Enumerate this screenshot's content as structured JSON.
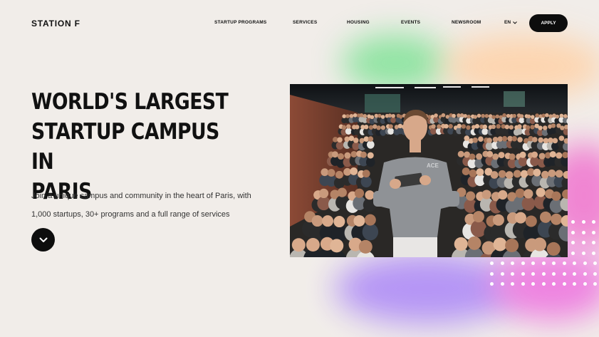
{
  "brand": {
    "name": "STATION F"
  },
  "nav": {
    "items": [
      "STARTUP PROGRAMS",
      "SERVICES",
      "HOUSING",
      "EVENTS",
      "NEWSROOM"
    ],
    "language": "EN",
    "cta_label": "APPLY"
  },
  "hero": {
    "title": "WORLD'S LARGEST\nSTARTUP CAMPUS IN\nPARIS",
    "subtitle": "Join a unique campus and community in the heart of Paris, with 1,000 startups, 30+ programs and a full range of services"
  },
  "icons": {
    "scroll": "chevron-down-icon",
    "language_caret": "chevron-down-icon"
  },
  "colors": {
    "background": "#f1ede9",
    "button": "#0d0d0d",
    "glow_green": "#86e39b",
    "glow_orange": "#ffd1a6",
    "glow_pink": "#f07ad0",
    "glow_purple": "#b291f6"
  }
}
